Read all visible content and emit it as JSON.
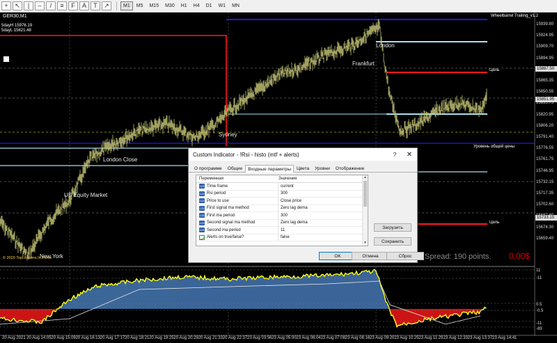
{
  "toolbar": {
    "icons": [
      "crosshair-icon",
      "pointer-icon",
      "vertical-line-icon",
      "horizontal-line-icon",
      "trendline-icon",
      "channel-icon",
      "fibonacci-icon",
      "text-icon",
      "label-icon",
      "arrow-icon"
    ],
    "timeframes": [
      "M1",
      "M5",
      "M15",
      "M30",
      "H1",
      "H4",
      "D1",
      "W1",
      "MN"
    ],
    "active_timeframe": "M1"
  },
  "chart": {
    "symbol": "GER30,M1",
    "indicator_name": "Wheelbarrel Trailing_v1.2",
    "day_high": "5dayH 15976.19",
    "day_low": "5dayL 15621.48",
    "copyright": "© 2020 TopLessons.In.Forex",
    "spread": "Spread: 190 points.",
    "profit": "0.00$",
    "session_labels": {
      "london": "London",
      "frankfurt": "Frankfurt",
      "sydney": "Sydney",
      "london_close": "London Close",
      "us_equity": "US Equity Market",
      "new_york": "New York"
    },
    "level_labels": {
      "level1": "Цель",
      "level2": "Уровень общей цены",
      "level3": "Цель"
    },
    "price_axis": [
      "15939.80",
      "15924.95",
      "15909.70",
      "15894.95",
      "15880.10",
      "15865.35",
      "15850.55",
      "15835.75",
      "15820.95",
      "15806.20",
      "15791.40",
      "15776.55",
      "15761.75",
      "15746.95",
      "15732.15",
      "15717.35",
      "15702.60",
      "15687.80",
      "15674.30",
      "15659.40"
    ],
    "price_tags": [
      "15887.50",
      "15851.95",
      "15733.15"
    ],
    "time_axis": [
      "20 Aug 2021",
      "20 Aug 14:05",
      "20 Aug 15:09",
      "20 Aug 16:13",
      "20 Aug 17:17",
      "20 Aug 18:21",
      "20 Aug 19:25",
      "20 Aug 20:29",
      "20 Aug 21:33",
      "20 Aug 22:37",
      "23 Aug 03:56",
      "23 Aug 05:00",
      "23 Aug 06:04",
      "23 Aug 07:08",
      "23 Aug 08:16",
      "23 Aug 09:20",
      "23 Aug 10:25",
      "23 Aug 11:29",
      "23 Aug 12:33",
      "23 Aug 13:37",
      "23 Aug 14:41"
    ],
    "sub_axis": [
      "11",
      "-11",
      "0.5",
      "-0.5",
      "-11",
      "-89"
    ],
    "colors": {
      "candles": "#c8c878",
      "red_level": "#ff1a1a",
      "blue_level": "#1a1aff",
      "light_level": "#a8e0f0",
      "histogram_up": "#4a7fbf",
      "histogram_down": "#ff1a1a",
      "osc_line": "#ffff1a"
    }
  },
  "dialog": {
    "title": "Custom Indicator - !Rsi - histo (mtf + alerts)",
    "help": "?",
    "close": "✕",
    "tabs": [
      "О программе",
      "Общие",
      "Входные параметры",
      "Цвета",
      "Уровни",
      "Отображение"
    ],
    "active_tab": 2,
    "table": {
      "headers": [
        "Переменная",
        "Значение"
      ],
      "rows": [
        {
          "name": "Time frame",
          "value": "current",
          "icon": "variable-icon"
        },
        {
          "name": "Rsi period",
          "value": "300",
          "icon": "variable-icon"
        },
        {
          "name": "Price to use",
          "value": "Close price",
          "icon": "variable-icon"
        },
        {
          "name": "First signal ma method",
          "value": "Zero lag dema",
          "icon": "variable-icon"
        },
        {
          "name": "First ma period",
          "value": "300",
          "icon": "variable-icon"
        },
        {
          "name": "Second signal ma method",
          "value": "Zero lag dema",
          "icon": "variable-icon"
        },
        {
          "name": "Second ma period",
          "value": "11",
          "icon": "variable-icon"
        },
        {
          "name": "Alerts on true/false?",
          "value": "false",
          "icon": "boolean-icon"
        }
      ]
    },
    "buttons": {
      "load": "Загрузить",
      "save": "Сохранить",
      "ok": "OK",
      "cancel": "Отмена",
      "reset": "Сброс"
    }
  }
}
